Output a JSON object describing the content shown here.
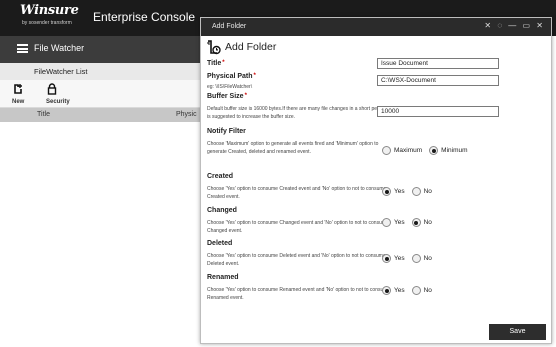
{
  "app": {
    "logo_text": "Winsure",
    "logo_sub": "by sosender transform",
    "title": "Enterprise Console"
  },
  "sidebar": {
    "nav_label": "File Watcher",
    "list_title": "FileWatcher List",
    "toolbar": [
      {
        "label": "New",
        "icon": "new-icon"
      },
      {
        "label": "Security",
        "icon": "lock-icon"
      }
    ],
    "columns": [
      "Title",
      "Physic"
    ]
  },
  "dialog": {
    "window_title": "Add Folder",
    "heading": "Add Folder",
    "title_label": "Title",
    "title_value": "Issue Document",
    "path_label": "Physical Path",
    "path_hint": "eg: \\\\IS\\FileWatcher\\",
    "path_value": "C:\\WSX-Document",
    "buffer_label": "Buffer Size",
    "buffer_desc": "Default buffer size is 16000 bytes.If there are many file changes in a short period,it is suggested to increase the buffer size.",
    "buffer_value": "10000",
    "notify_label": "Notify Filter",
    "notify_desc": "Choose 'Maximum' option to generate all events fired and 'Minimum' option to generate Created, deleted and renamed event.",
    "notify_options": [
      "Maximum",
      "Minimum"
    ],
    "notify_selected": "Minimum",
    "created_label": "Created",
    "created_desc": "Choose 'Yes' option to consume Created event and 'No' option to not to consume Created event.",
    "created_selected": "Yes",
    "changed_label": "Changed",
    "changed_desc": "Choose 'Yes' option to consume Changed event and 'No' option to not to consume Changed event.",
    "changed_selected": "No",
    "deleted_label": "Deleted",
    "deleted_desc": "Choose 'Yes' option to consume Deleted event and 'No' option to not to consume Deleted event.",
    "deleted_selected": "Yes",
    "renamed_label": "Renamed",
    "renamed_desc": "Choose 'Yes' option to consume Renamed event and 'No' option to not to consume Renamed event.",
    "renamed_selected": "Yes",
    "yes": "Yes",
    "no": "No",
    "save_label": "Save",
    "window_controls": "✕ ◌ — ▭ ✕"
  },
  "colors": {
    "topbar": "#1b1b1b",
    "nav": "#3c3c3c",
    "dialog_title": "#2b2b2b",
    "required": "#cc0000",
    "save_button": "#2d2d2d"
  }
}
